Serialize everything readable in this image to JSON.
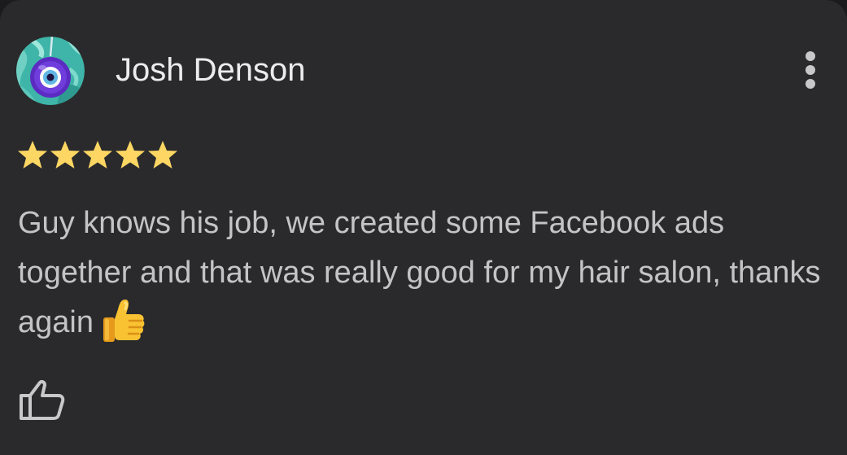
{
  "review": {
    "reviewer_name": "Josh Denson",
    "avatar_icon": "evil-eye-avatar-icon",
    "rating": 5,
    "max_rating": 5,
    "star_color": "#fdd663",
    "text": "Guy knows his job, we created some Facebook ads together and that was really good for my hair salon, thanks again",
    "emoji": "thumbs-up-emoji"
  },
  "actions": {
    "more_icon": "more-vert-icon",
    "like_icon": "thumb-up-outline-icon"
  },
  "colors": {
    "card_background": "#2a2a2c",
    "name_text": "#ececee",
    "body_text": "#c4c4c6",
    "icon": "#c8c8ca"
  }
}
